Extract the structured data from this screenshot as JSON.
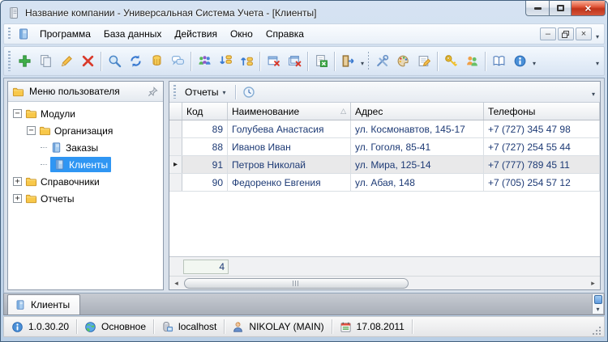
{
  "window": {
    "title": "Название компании - Универсальная Система Учета - [Клиенты]"
  },
  "menu": {
    "items": [
      {
        "label": "Программа"
      },
      {
        "label": "База данных"
      },
      {
        "label": "Действия"
      },
      {
        "label": "Окно"
      },
      {
        "label": "Справка"
      }
    ]
  },
  "toolbar": {
    "icons": [
      "add",
      "copy",
      "edit",
      "delete",
      "search",
      "refresh",
      "filter-data",
      "comments",
      "contacts",
      "expand-tree",
      "collapse-tree",
      "close-window",
      "close-all-windows",
      "export-excel",
      "exit",
      "settings",
      "appearance",
      "edit-form",
      "access-key",
      "users",
      "help-book",
      "about"
    ]
  },
  "sidebar": {
    "header": "Меню пользователя",
    "tree": [
      {
        "label": "Модули",
        "type": "folder",
        "state": "expanded"
      },
      {
        "label": "Организация",
        "type": "folder",
        "state": "expanded"
      },
      {
        "label": "Заказы",
        "type": "document"
      },
      {
        "label": "Клиенты",
        "type": "document",
        "selected": true
      },
      {
        "label": "Справочники",
        "type": "folder",
        "state": "collapsed"
      },
      {
        "label": "Отчеты",
        "type": "folder",
        "state": "collapsed"
      }
    ]
  },
  "grid_toolbar": {
    "reports_label": "Отчеты",
    "icons": [
      "clock"
    ]
  },
  "table": {
    "columns": {
      "code": "Код",
      "name": "Наименование",
      "address": "Адрес",
      "phones": "Телефоны"
    },
    "sort": {
      "column": "Наименование",
      "direction": "asc"
    },
    "rows": [
      {
        "code": "89",
        "name": "Голубева Анастасия",
        "address": "ул. Космонавтов, 145-17",
        "phone": "+7 (727) 345 47 98"
      },
      {
        "code": "88",
        "name": "Иванов Иван",
        "address": "ул. Гоголя, 85-41",
        "phone": "+7 (727) 254 55 44"
      },
      {
        "code": "91",
        "name": "Петров Николай",
        "address": "ул. Мира, 125-14",
        "phone": "+7 (777) 789 45 11",
        "selected": true
      },
      {
        "code": "90",
        "name": "Федоренко Евгения",
        "address": "ул. Абая, 148",
        "phone": "+7 (705) 254 57 12"
      }
    ],
    "summary_count": "4"
  },
  "tabs": {
    "active": "Клиенты"
  },
  "status_bar": {
    "version": "1.0.30.20",
    "database": "Основное",
    "server": "localhost",
    "user": "NIKOLAY (MAIN)",
    "date": "17.08.2011"
  },
  "colors": {
    "selection_blue": "#2f96f3",
    "close_button_red": "#c0341a",
    "folder_yellow": "#f8c84a",
    "grid_text_navy": "#1d3a75",
    "frame_blue": "#b9cfe6"
  }
}
